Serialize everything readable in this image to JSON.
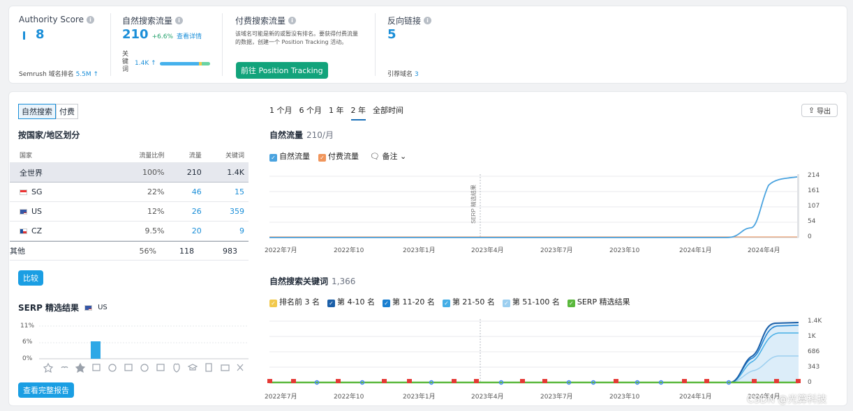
{
  "summary": {
    "authority": {
      "label": "Authority Score",
      "value": "8",
      "rank_label": "Semrush 域名排名",
      "rank_value": "5.5M ↑"
    },
    "organic": {
      "label": "自然搜索流量",
      "value": "210",
      "change": "+6.6%",
      "link": "查看详情",
      "kw_label": "关键词",
      "kw_value": "1.4K ↑"
    },
    "paid": {
      "label": "付费搜索流量",
      "note": "该域名可能是新的或暂没有排名。要获得付费流量的数据，创建一个 Position Tracking 活动。",
      "button": "前往 Position Tracking"
    },
    "backlinks": {
      "label": "反向链接",
      "value": "5",
      "ref_label": "引荐域名",
      "ref_value": "3"
    }
  },
  "toggle": {
    "organic": "自然搜索",
    "paid": "付费"
  },
  "country": {
    "title": "按国家/地区划分",
    "headers": [
      "国家",
      "流量比例",
      "流量",
      "关键词"
    ],
    "rows": [
      {
        "name": "全世界",
        "share": 1.0,
        "share_label": "100%",
        "traffic": "210",
        "keywords": "1.4K"
      },
      {
        "name": "SG",
        "share": 0.22,
        "share_label": "22%",
        "traffic": "46",
        "keywords": "15"
      },
      {
        "name": "US",
        "share": 0.12,
        "share_label": "12%",
        "traffic": "26",
        "keywords": "359"
      },
      {
        "name": "CZ",
        "share": 0.095,
        "share_label": "9.5%",
        "traffic": "20",
        "keywords": "9"
      },
      {
        "name": "其他",
        "share": 0.56,
        "share_label": "56%",
        "traffic": "118",
        "keywords": "983"
      }
    ],
    "compare": "比较"
  },
  "serp": {
    "title": "SERP 精选结果",
    "country": "US",
    "yticks": [
      "11%",
      "6%",
      "0%"
    ],
    "full_report": "查看完整报告"
  },
  "range_tabs": [
    "1 个月",
    "6 个月",
    "1 年",
    "2 年",
    "全部时间"
  ],
  "export": "导出",
  "traffic_chart": {
    "title": "自然流量",
    "value": "210/月",
    "legend": [
      "自然流量",
      "付费流量"
    ],
    "notes": "备注",
    "serp_marker": "SERP 精选结果",
    "yticks": [
      "214",
      "161",
      "107",
      "54",
      "0"
    ],
    "xticks": [
      "2022年7月",
      "2022年10",
      "2023年1月",
      "2023年4月",
      "2023年7月",
      "2023年10",
      "2024年1月",
      "2024年4月"
    ]
  },
  "kw_chart": {
    "title": "自然搜索关键词",
    "value": "1,366",
    "legend": [
      "排名前 3 名",
      "第 4-10 名",
      "第 11-20 名",
      "第 21-50 名",
      "第 51-100 名",
      "SERP 精选结果"
    ],
    "yticks": [
      "1.4K",
      "1K",
      "686",
      "343",
      "0"
    ],
    "xticks": [
      "2022年7月",
      "2022年10",
      "2023年1月",
      "2023年4月",
      "2023年7月",
      "2023年10",
      "2024年1月",
      "2024年4月"
    ]
  },
  "colors": {
    "accent": "#1a8ed8",
    "green": "#12a37b",
    "line": "#4aa3df"
  },
  "watermark": "CSDN @光算科技"
}
